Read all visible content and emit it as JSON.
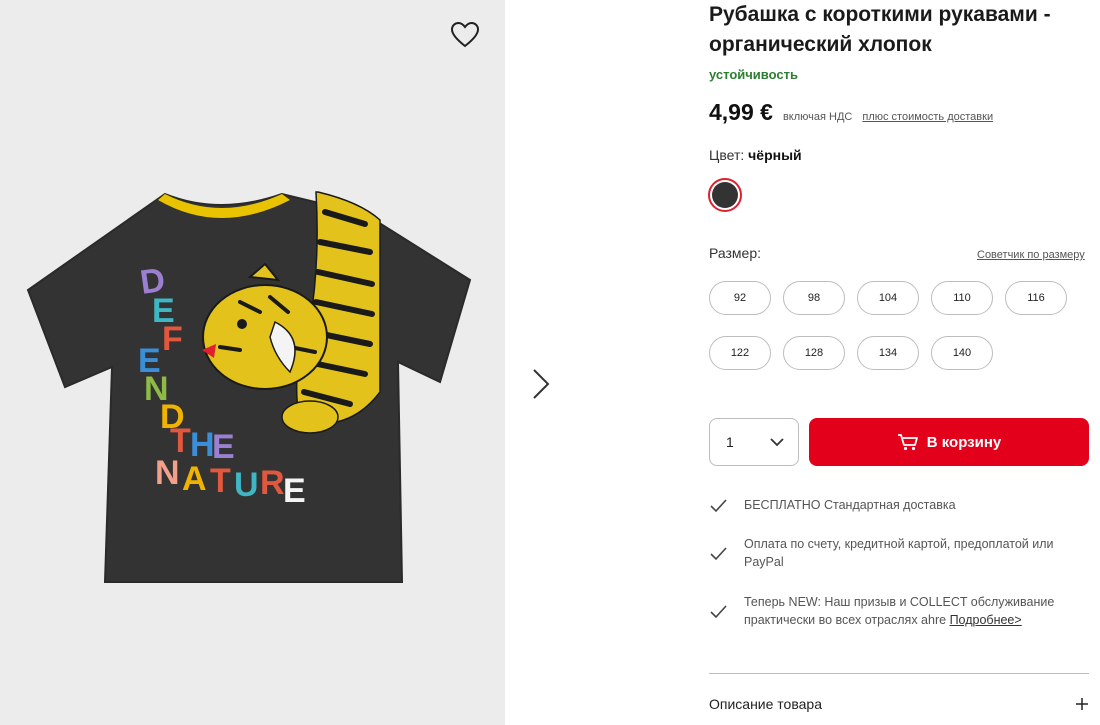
{
  "product": {
    "title": "Рубашка с короткими рукавами - органический хлопок",
    "sustainability_label": "устойчивость",
    "price": "4,99 €",
    "vat_text": "включая НДС",
    "shipping_link": "плюс стоимость доставки",
    "image_alt_letters": "DEFEND THE NATURE"
  },
  "color": {
    "label": "Цвет:",
    "value": "чёрный",
    "swatch_hex": "#333333",
    "selected_ring_hex": "#e0202e"
  },
  "size": {
    "label": "Размер:",
    "advisor_link": "Советчик по размеру",
    "options": [
      "92",
      "98",
      "104",
      "110",
      "116",
      "122",
      "128",
      "134",
      "140"
    ]
  },
  "purchase": {
    "quantity": "1",
    "add_to_cart": "В корзину",
    "button_color": "#e3001b"
  },
  "benefits": [
    {
      "text": "БЕСПЛАТНО Стандартная доставка"
    },
    {
      "text": "Оплата по счету, кредитной картой, предоплатой или PayPal"
    },
    {
      "text": "Теперь NEW: Наш призыв и COLLECT обслуживание практически во всех отраслях ahre",
      "link": "Подробнее>"
    }
  ],
  "description": {
    "label": "Описание товара",
    "expand_icon": "plus-icon"
  },
  "icons": {
    "wishlist": "heart-icon",
    "next": "chevron-right-icon",
    "cart": "cart-icon",
    "check": "check-icon"
  }
}
